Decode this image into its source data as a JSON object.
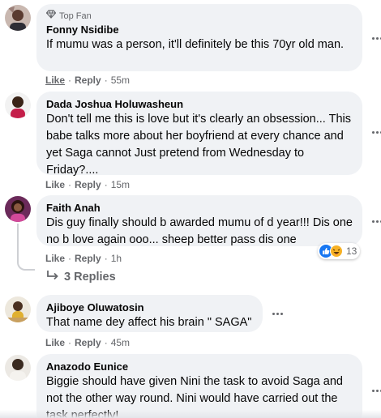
{
  "comments": [
    {
      "badge": "Top Fan",
      "author": "Fonny Nsidibe",
      "text": "If mumu was a person, it'll definitely be this 70yr old man.",
      "like": "Like",
      "reply": "Reply",
      "time": "55m"
    },
    {
      "author": "Dada Joshua Holuwasheun",
      "text": "Don't tell me this is love but it's clearly an obsession... This babe talks more about her boyfriend at every chance and yet Saga cannot Just pretend from Wednesday to Friday?....",
      "like": "Like",
      "reply": "Reply",
      "time": "15m"
    },
    {
      "author": "Faith Anah",
      "text": "Dis guy finally should b awarded mumu of d year!!! Dis one no b love again ooo... sheep better pass dis one",
      "like": "Like",
      "reply": "Reply",
      "time": "1h",
      "reaction_count": "13",
      "replies_label": "3 Replies"
    },
    {
      "author": "Ajiboye Oluwatosin",
      "text": "That name dey affect his brain \" SAGA\"",
      "like": "Like",
      "reply": "Reply",
      "time": "45m"
    },
    {
      "author": "Anazodo Eunice",
      "text": "Biggie should have given Nini the task to avoid Saga and not the other way round. Nini would have carried out the task perfectly!"
    }
  ],
  "separator": "·",
  "icons": {
    "badge": "diamond-icon",
    "more": "more-options-icon",
    "reply_arrow": "reply-arrow-icon",
    "like_reaction": "like-reaction-icon",
    "haha_reaction": "haha-reaction-icon"
  },
  "colors": {
    "bubble": "#f0f2f5",
    "secondary_text": "#65676b",
    "like_blue": "#1877f2",
    "haha_yellow": "#f7b125"
  }
}
